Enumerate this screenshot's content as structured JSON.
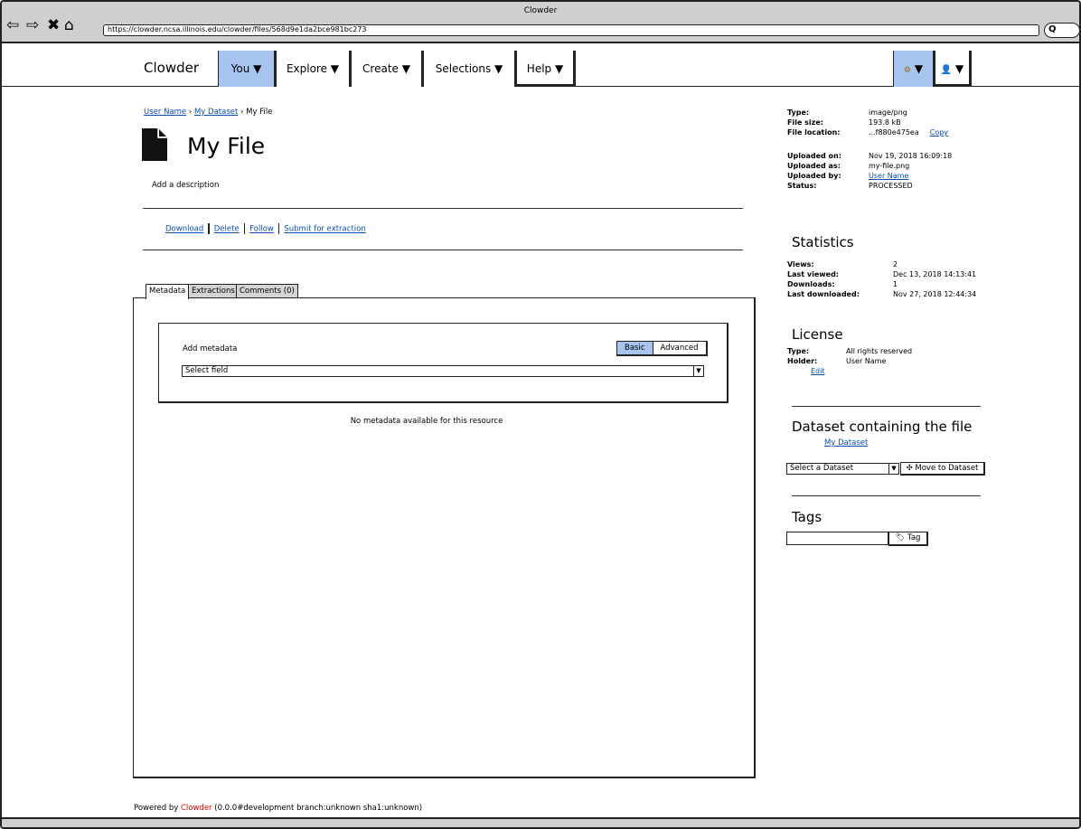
{
  "window": {
    "title": "Clowder",
    "url": "https://clowder.ncsa.illinois.edu/clowder/files/568d9e1da2bce981bc273"
  },
  "nav": {
    "brand": "Clowder",
    "menus": [
      {
        "label": "You ▼"
      },
      {
        "label": "Explore ▼"
      },
      {
        "label": "Create ▼"
      },
      {
        "label": "Selections ▼"
      },
      {
        "label": "Help ▼"
      }
    ],
    "settings_arrow": "▼",
    "user_arrow": "▼"
  },
  "breadcrumb": {
    "user": "User Name",
    "dataset": "My Dataset",
    "current": "My File",
    "separator": "›"
  },
  "file": {
    "title": "My File",
    "description_placeholder": "Add a description"
  },
  "actions": {
    "download": "Download",
    "delete": "Delete",
    "follow": "Follow",
    "extract": "Submit for extraction"
  },
  "tabs": [
    {
      "label": "Metadata"
    },
    {
      "label": "Extractions"
    },
    {
      "label": "Comments (0)"
    }
  ],
  "metadata": {
    "add_label": "Add metadata",
    "basic": "Basic",
    "advanced": "Advanced",
    "select_placeholder": "Select field",
    "empty_text": "No metadata available for this resource"
  },
  "file_info": {
    "type_label": "Type:",
    "type": "image/png",
    "size_label": "File size:",
    "size": "193.8 kB",
    "location_label": "File location:",
    "location": "...f880e475ea",
    "copy": "Copy",
    "uploaded_on_label": "Uploaded on:",
    "uploaded_on": "Nov 19, 2018 16:09:18",
    "uploaded_as_label": "Uploaded as:",
    "uploaded_as": "my-file.png",
    "uploaded_by_label": "Uploaded by:",
    "uploaded_by": "User Name",
    "status_label": "Status:",
    "status": "PROCESSED"
  },
  "statistics": {
    "heading": "Statistics",
    "views_label": "Views:",
    "views": "2",
    "last_viewed_label": "Last viewed:",
    "last_viewed": "Dec 13, 2018 14:13:41",
    "downloads_label": "Downloads:",
    "downloads": "1",
    "last_downloaded_label": "Last downloaded:",
    "last_downloaded": "Nov 27, 2018 12:44:34"
  },
  "license": {
    "heading": "License",
    "type_label": "Type:",
    "type": "All rights reserved",
    "holder_label": "Holder:",
    "holder": "User Name",
    "edit": "Edit"
  },
  "dataset_section": {
    "heading": "Dataset containing the file",
    "dataset_link": "My Dataset",
    "select_placeholder": "Select a Dataset",
    "move_button": "Move to Dataset"
  },
  "tags": {
    "heading": "Tags",
    "button": "Tag"
  },
  "footer": {
    "prefix": "Powered by ",
    "brand": "Clowder",
    "version": " (0.0.0#development branch:unknown sha1:unknown)"
  }
}
